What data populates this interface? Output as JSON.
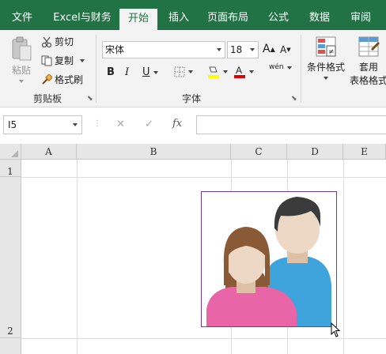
{
  "tabs": [
    "文件",
    "Excel与财务",
    "开始",
    "插入",
    "页面布局",
    "公式",
    "数据",
    "审阅"
  ],
  "active_tab": "开始",
  "clipboard": {
    "paste_label": "粘贴",
    "cut_label": "剪切",
    "copy_label": "复制",
    "format_painter_label": "格式刷",
    "group_label": "剪贴板"
  },
  "font": {
    "font_name": "宋体",
    "font_size": "18",
    "bold": "B",
    "italic": "I",
    "underline": "U",
    "increase_size": "A",
    "decrease_size": "A",
    "phonetic": "wén",
    "group_label": "字体"
  },
  "styles": {
    "conditional_format_label": "条件格式",
    "table_format_line1": "套用",
    "table_format_line2": "表格格式"
  },
  "formula_bar": {
    "name_box": "I5",
    "cancel": "✕",
    "enter": "✓",
    "fx": "fx",
    "formula": ""
  },
  "columns": [
    "A",
    "B",
    "C",
    "D",
    "E"
  ],
  "rows": [
    "1",
    "2"
  ],
  "colors": {
    "accent": "#217346",
    "selection_border": "#7a3a9a",
    "hair_dark": "#3b3b3b",
    "woman_hair": "#8a5a36",
    "skin": "#ecd8c4",
    "woman_shirt": "#e866a8",
    "man_shirt": "#3fa3dc"
  }
}
